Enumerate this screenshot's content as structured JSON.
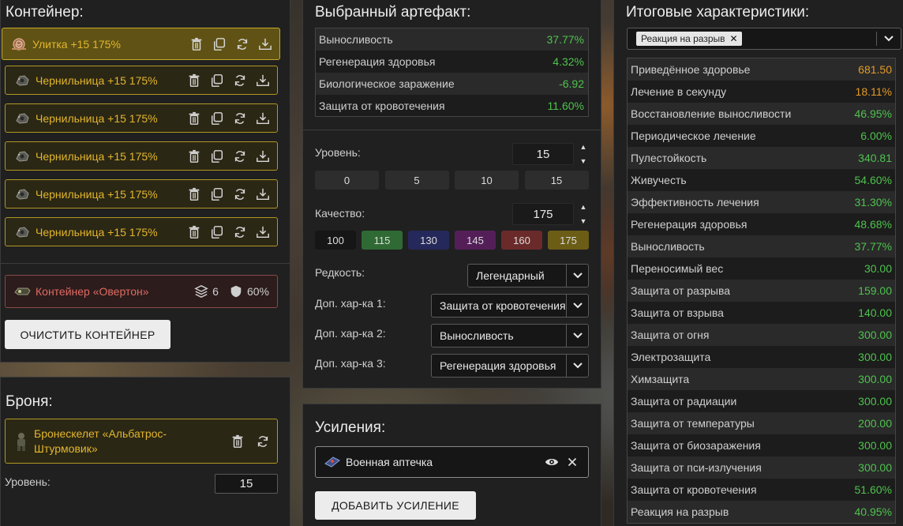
{
  "container": {
    "title": "Контейнер:",
    "artifacts": [
      {
        "name": "Улитка +15 175%",
        "icon": "snail-artifact-icon"
      },
      {
        "name": "Чернильница +15 175%",
        "icon": "inkwell-artifact-icon"
      },
      {
        "name": "Чернильница +15 175%",
        "icon": "inkwell-artifact-icon"
      },
      {
        "name": "Чернильница +15 175%",
        "icon": "inkwell-artifact-icon"
      },
      {
        "name": "Чернильница +15 175%",
        "icon": "inkwell-artifact-icon"
      },
      {
        "name": "Чернильница +15 175%",
        "icon": "inkwell-artifact-icon"
      }
    ],
    "container_item": {
      "name": "Контейнер «Овертон»",
      "slots": "6",
      "protection": "60%"
    },
    "clear_label": "ОЧИСТИТЬ КОНТЕЙНЕР"
  },
  "armor": {
    "title": "Броня:",
    "name": "Бронескелет «Альбатрос-Штурмовик»",
    "level_label": "Уровень:",
    "level_value": "15"
  },
  "artifact": {
    "title": "Выбранный артефакт:",
    "stats": [
      {
        "label": "Выносливость",
        "value": "37.77%",
        "color": "green"
      },
      {
        "label": "Регенерация здоровья",
        "value": "4.32%",
        "color": "green"
      },
      {
        "label": "Биологическое заражение",
        "value": "-6.92",
        "color": "green"
      },
      {
        "label": "Защита от кровотечения",
        "value": "11.60%",
        "color": "green"
      }
    ],
    "level_label": "Уровень:",
    "level_value": "15",
    "level_presets": [
      "0",
      "5",
      "10",
      "15"
    ],
    "quality_label": "Качество:",
    "quality_value": "175",
    "quality_presets": [
      {
        "label": "100",
        "color": "#161616"
      },
      {
        "label": "115",
        "color": "#2f6a34"
      },
      {
        "label": "130",
        "color": "#25285a"
      },
      {
        "label": "145",
        "color": "#541f59"
      },
      {
        "label": "160",
        "color": "#6b2a2a"
      },
      {
        "label": "175",
        "color": "#6b5d16"
      }
    ],
    "rarity_label": "Редкость:",
    "rarity_value": "Легендарный",
    "extra1_label": "Доп. хар-ка 1:",
    "extra1_value": "Защита от кровотечения",
    "extra2_label": "Доп. хар-ка 2:",
    "extra2_value": "Выносливость",
    "extra3_label": "Доп. хар-ка 3:",
    "extra3_value": "Регенерация здоровья"
  },
  "boosts": {
    "title": "Усиления:",
    "item": "Военная аптечка",
    "add_label": "ДОБАВИТЬ УСИЛЕНИЕ"
  },
  "totals": {
    "title": "Итоговые характеристики:",
    "filter_chip": "Реакция на разрыв",
    "rows": [
      {
        "label": "Приведённое здоровье",
        "value": "681.50",
        "color": "orange"
      },
      {
        "label": "Лечение в секунду",
        "value": "18.11%",
        "color": "orange"
      },
      {
        "label": "Восстановление выносливости",
        "value": "46.95%",
        "color": "green"
      },
      {
        "label": "Периодическое лечение",
        "value": "6.00%",
        "color": "green"
      },
      {
        "label": "Пулестойкость",
        "value": "340.81",
        "color": "green"
      },
      {
        "label": "Живучесть",
        "value": "54.60%",
        "color": "green"
      },
      {
        "label": "Эффективность лечения",
        "value": "31.30%",
        "color": "green"
      },
      {
        "label": "Регенерация здоровья",
        "value": "48.68%",
        "color": "green"
      },
      {
        "label": "Выносливость",
        "value": "37.77%",
        "color": "green"
      },
      {
        "label": "Переносимый вес",
        "value": "30.00",
        "color": "green"
      },
      {
        "label": "Защита от разрыва",
        "value": "159.00",
        "color": "green"
      },
      {
        "label": "Защита от взрыва",
        "value": "140.00",
        "color": "green"
      },
      {
        "label": "Защита от огня",
        "value": "300.00",
        "color": "green"
      },
      {
        "label": "Электрозащита",
        "value": "300.00",
        "color": "green"
      },
      {
        "label": "Химзащита",
        "value": "300.00",
        "color": "green"
      },
      {
        "label": "Защита от радиации",
        "value": "300.00",
        "color": "green"
      },
      {
        "label": "Защита от температуры",
        "value": "200.00",
        "color": "green"
      },
      {
        "label": "Защита от биозаражения",
        "value": "300.00",
        "color": "green"
      },
      {
        "label": "Защита от пси-излучения",
        "value": "300.00",
        "color": "green"
      },
      {
        "label": "Защита от кровотечения",
        "value": "51.60%",
        "color": "green"
      },
      {
        "label": "Реакция на разрыв",
        "value": "40.95%",
        "color": "green"
      }
    ]
  }
}
